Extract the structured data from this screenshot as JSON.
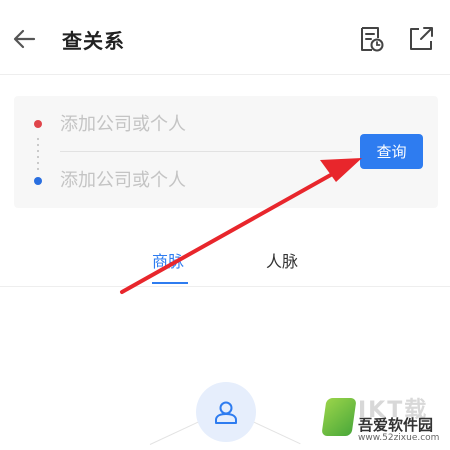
{
  "header": {
    "title": "查关系",
    "icons": {
      "back": "arrow-left-icon",
      "history": "history-list-icon",
      "share": "share-external-icon"
    }
  },
  "search": {
    "from_placeholder": "添加公司或个人",
    "to_placeholder": "添加公司或个人",
    "query_label": "查询",
    "colors": {
      "from_dot": "#e0454b",
      "to_dot": "#2a6fe0",
      "accent": "#2e7cf0"
    }
  },
  "tabs": [
    {
      "label": "商脉",
      "active": true
    },
    {
      "label": "人脉",
      "active": false
    }
  ],
  "graph": {
    "center_icon": "person-icon"
  },
  "annotation": {
    "arrow_color": "#e8262c"
  },
  "watermark": {
    "name": "吾爱软件园",
    "url": "www.52zixue.com",
    "overlay_text": "IKT载"
  }
}
